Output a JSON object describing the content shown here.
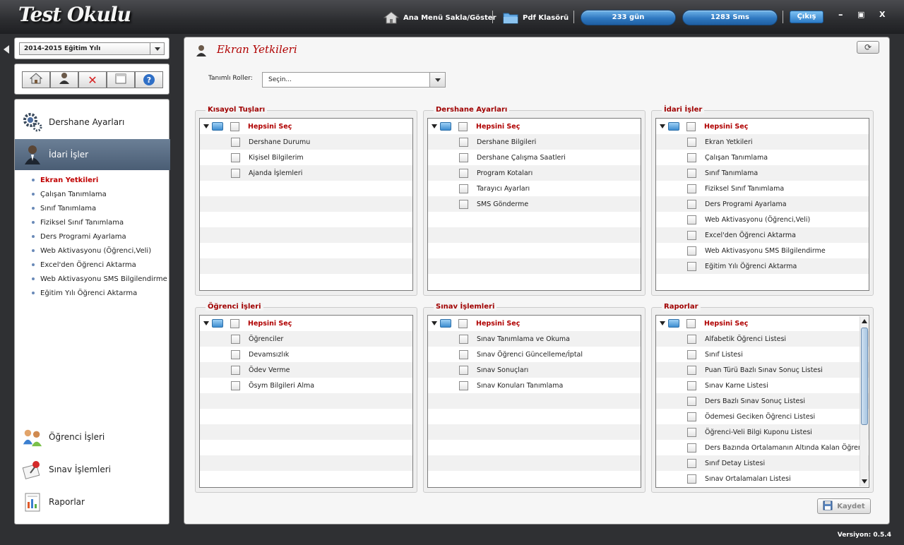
{
  "app": {
    "logo": "Test Okulu"
  },
  "topbar": {
    "menu_toggle": "Ana Menü Sakla/Göster",
    "pdf": "Pdf Klasörü",
    "days": "233 gün",
    "sms": "1283 Sms",
    "exit": "Çıkış",
    "minimize": "–",
    "restore": "▣",
    "close": "X"
  },
  "sidebar": {
    "year": "2014-2015 Eğitim Yılı",
    "sections": [
      {
        "label": "Dershane Ayarları",
        "icon": "gears-icon"
      },
      {
        "label": "İdari İşler",
        "icon": "manager-icon"
      },
      {
        "label": "Öğrenci İşleri",
        "icon": "students-icon"
      },
      {
        "label": "Sınav İşlemleri",
        "icon": "exam-pin-icon"
      },
      {
        "label": "Raporlar",
        "icon": "report-icon"
      }
    ],
    "sub_items": [
      "Ekran Yetkileri",
      "Çalışan Tanımlama",
      "Sınıf Tanımlama",
      "Fiziksel Sınıf Tanımlama",
      "Ders Programi Ayarlama",
      "Web Aktivasyonu (Öğrenci,Veli)",
      "Excel'den Öğrenci Aktarma",
      "Web Aktivasyonu SMS Bilgilendirme",
      "Eğitim Yılı Öğrenci Aktarma"
    ]
  },
  "main": {
    "title": "Ekran Yetkileri",
    "roles_label": "Tanımlı Roller:",
    "roles_value": "Seçin...",
    "select_all": "Hepsini Seç",
    "save": "Kaydet",
    "groups": [
      {
        "title": "Kısayol Tuşları",
        "items": [
          "Dershane Durumu",
          "Kişisel Bilgilerim",
          "Ajanda İşlemleri"
        ]
      },
      {
        "title": "Dershane Ayarları",
        "items": [
          "Dershane Bilgileri",
          "Dershane Çalışma Saatleri",
          "Program Kotaları",
          "Tarayıcı Ayarları",
          "SMS Gönderme"
        ]
      },
      {
        "title": "İdari İşler",
        "items": [
          "Ekran Yetkileri",
          "Çalışan Tanımlama",
          "Sınıf Tanımlama",
          "Fiziksel Sınıf Tanımlama",
          "Ders Programi Ayarlama",
          "Web Aktivasyonu (Öğrenci,Veli)",
          "Excel'den Öğrenci Aktarma",
          "Web Aktivasyonu SMS Bilgilendirme",
          "Eğitim Yılı Öğrenci Aktarma"
        ]
      },
      {
        "title": "Öğrenci İşleri",
        "items": [
          "Öğrenciler",
          "Devamsızlık",
          "Ödev Verme",
          "Ösym Bilgileri Alma"
        ]
      },
      {
        "title": "Sınav İşlemleri",
        "items": [
          "Sınav Tanımlama ve Okuma",
          "Sınav Öğrenci Güncelleme/İptal",
          "Sınav Sonuçları",
          "Sınav Konuları Tanımlama"
        ]
      },
      {
        "title": "Raporlar",
        "items": [
          "Alfabetik Öğrenci Listesi",
          "Sınıf Listesi",
          "Puan Türü Bazlı Sınav Sonuç Listesi",
          "Sınav Karne Listesi",
          "Ders Bazlı Sınav Sonuç Listesi",
          "Ödemesi Geciken Öğrenci Listesi",
          "Öğrenci-Veli Bilgi Kuponu Listesi",
          "Ders Bazında Ortalamanın Altında Kalan Öğrenci Listesi",
          "Sınıf Detay Listesi",
          "Sınav Ortalamaları Listesi"
        ]
      }
    ]
  },
  "footer": {
    "version": "Versiyon: 0.5.4"
  }
}
